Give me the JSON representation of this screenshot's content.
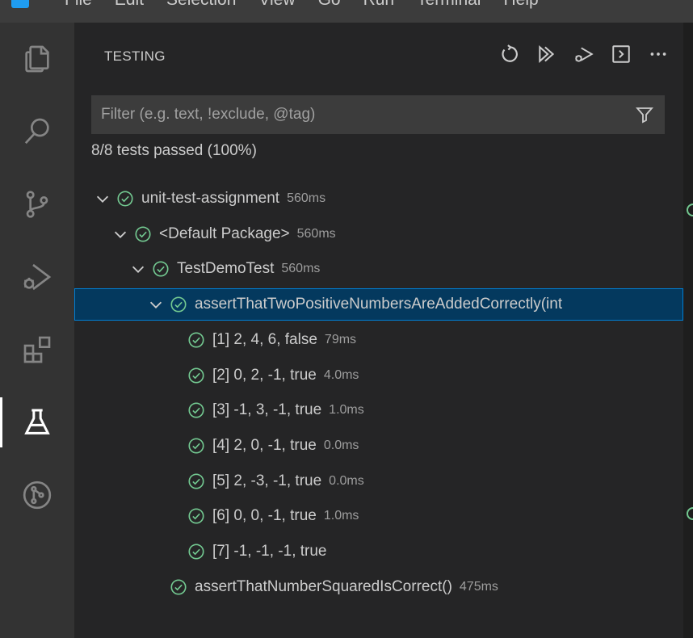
{
  "menubar": {
    "items": [
      "File",
      "Edit",
      "Selection",
      "View",
      "Go",
      "Run",
      "Terminal",
      "Help"
    ]
  },
  "activity_bar": {
    "items": [
      {
        "name": "explorer",
        "icon": "files-icon"
      },
      {
        "name": "search",
        "icon": "search-icon"
      },
      {
        "name": "source-control",
        "icon": "source-control-icon"
      },
      {
        "name": "run-and-debug",
        "icon": "run-debug-icon"
      },
      {
        "name": "extensions",
        "icon": "extensions-icon"
      },
      {
        "name": "testing",
        "icon": "beaker-icon",
        "active": true
      },
      {
        "name": "gitlens",
        "icon": "git-graph-icon"
      }
    ]
  },
  "testing": {
    "title": "TESTING",
    "toolbar": [
      "refresh-icon",
      "run-all-icon",
      "debug-all-icon",
      "show-output-icon",
      "more-actions-icon"
    ],
    "filter_placeholder": "Filter (e.g. text, !exclude, @tag)",
    "summary": "8/8 tests passed (100%)",
    "tree": [
      {
        "label": "unit-test-assignment",
        "duration": "560ms",
        "depth": 0,
        "expanded": true
      },
      {
        "label": "<Default Package>",
        "duration": "560ms",
        "depth": 1,
        "expanded": true
      },
      {
        "label": "TestDemoTest",
        "duration": "560ms",
        "depth": 2,
        "expanded": true
      },
      {
        "label": "assertThatTwoPositiveNumbersAreAddedCorrectly(int",
        "duration": "",
        "depth": 3,
        "expanded": true,
        "selected": true
      },
      {
        "label": "[1] 2, 4, 6, false",
        "duration": "79ms",
        "depth": 4
      },
      {
        "label": "[2] 0, 2, -1, true",
        "duration": "4.0ms",
        "depth": 4
      },
      {
        "label": "[3] -1, 3, -1, true",
        "duration": "1.0ms",
        "depth": 4
      },
      {
        "label": "[4] 2, 0, -1, true",
        "duration": "0.0ms",
        "depth": 4
      },
      {
        "label": "[5] 2, -3, -1, true",
        "duration": "0.0ms",
        "depth": 4
      },
      {
        "label": "[6] 0, 0, -1, true",
        "duration": "1.0ms",
        "depth": 4
      },
      {
        "label": "[7] -1, -1, -1, true",
        "duration": "",
        "depth": 4
      },
      {
        "label": "assertThatNumberSquaredIsCorrect()",
        "duration": "475ms",
        "depth": 3
      }
    ]
  },
  "colors": {
    "pass": "#73c991",
    "selection_bg": "#04395e",
    "selection_border": "#007fd4"
  }
}
